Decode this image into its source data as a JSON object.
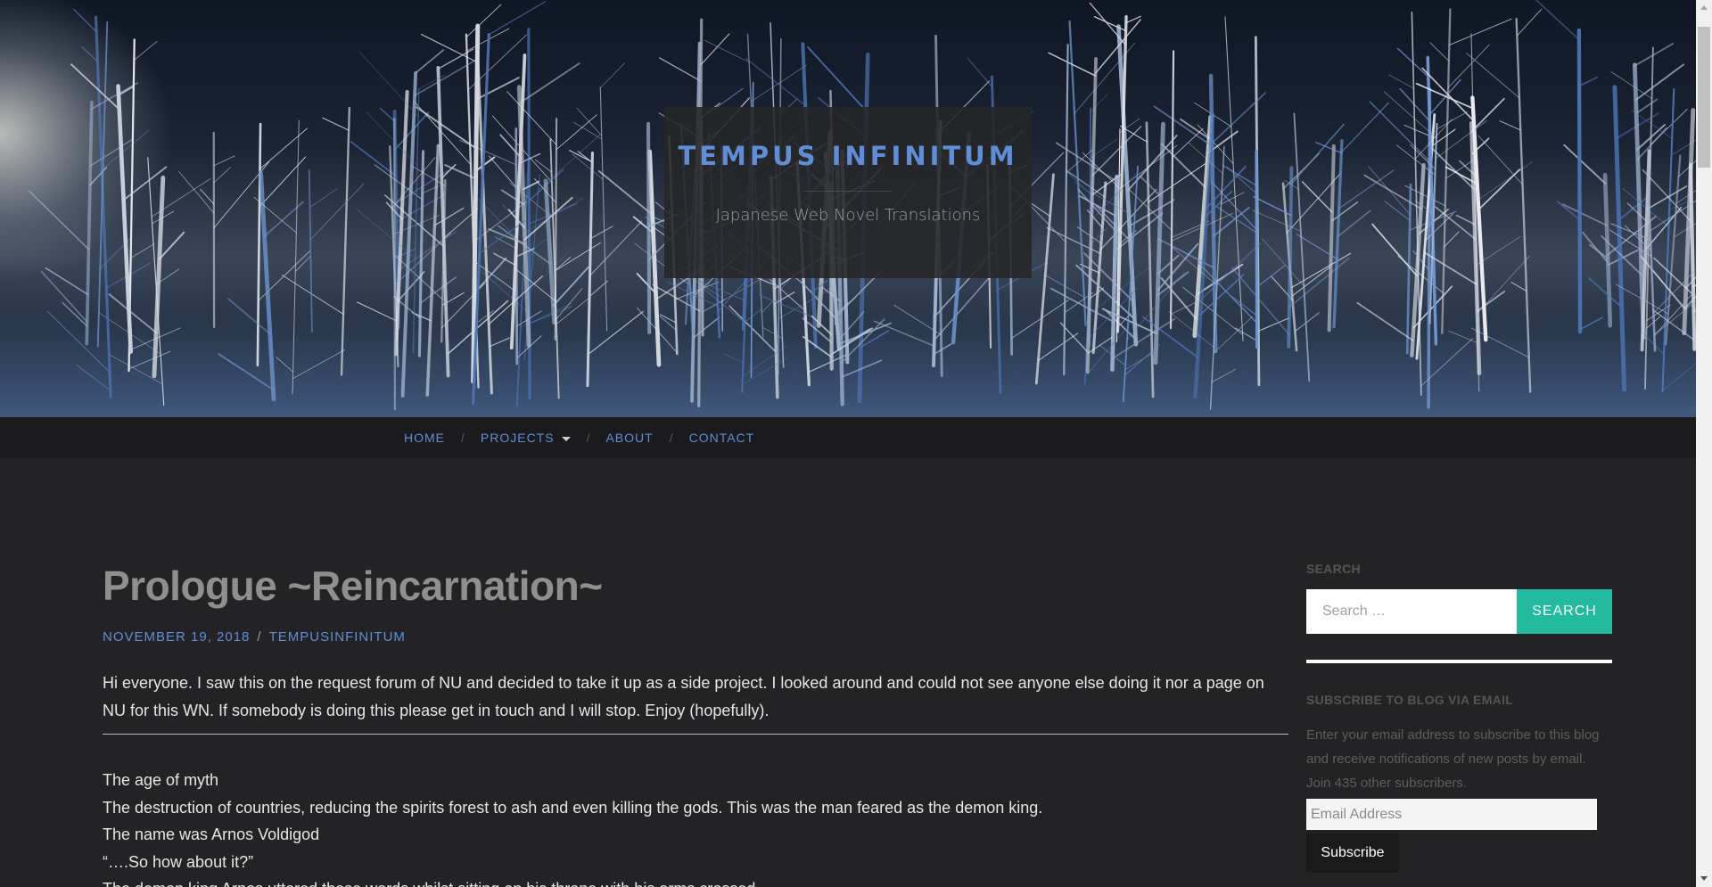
{
  "header": {
    "site_title": "TEMPUS INFINITUM",
    "site_description": "Japanese Web Novel Translations"
  },
  "nav": {
    "items": [
      {
        "label": "HOME"
      },
      {
        "label": "PROJECTS",
        "has_dropdown": true
      },
      {
        "label": "ABOUT"
      },
      {
        "label": "CONTACT"
      }
    ],
    "separator": "/"
  },
  "post": {
    "title": "Prologue ~Reincarnation~",
    "date": "NOVEMBER 19, 2018",
    "meta_separator": "/",
    "author": "TEMPUSINFINITUM",
    "intro": "Hi everyone. I saw this on the request forum of NU and decided to take it up as a side project. I looked around and could not see anyone else doing it nor a page on NU for this WN. If somebody is doing this please get in touch and I will stop. Enjoy (hopefully).",
    "lines": [
      "The age of myth",
      "The destruction of countries, reducing the spirits forest to ash and even killing the gods. This was the man feared as the demon king.",
      "The name was Arnos Voldigod",
      "“….So how about it?”",
      "The demon king Arnos uttered these words whilst sitting on his throne with his arms crossed."
    ]
  },
  "sidebar": {
    "search": {
      "title": "SEARCH",
      "placeholder": "Search …",
      "button": "SEARCH"
    },
    "subscribe": {
      "title": "SUBSCRIBE TO BLOG VIA EMAIL",
      "text": "Enter your email address to subscribe to this blog and receive notifications of new posts by email. Join 435 other subscribers.",
      "email_placeholder": "Email Address",
      "button": "Subscribe"
    }
  },
  "colors": {
    "accent_link": "#5f8ed6",
    "search_button": "#22bba0",
    "background": "#232325",
    "nav_background": "#1b1b1d"
  }
}
